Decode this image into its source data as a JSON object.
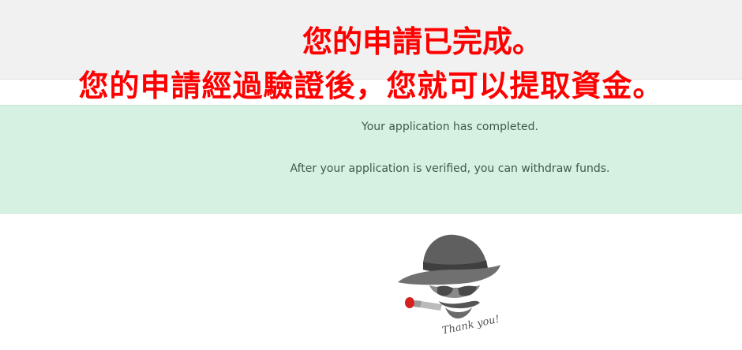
{
  "overlay": {
    "title_line1": "您的申請已完成。",
    "title_line2": "您的申請經過驗證後，您就可以提取資金。"
  },
  "notice": {
    "line1": "Your application has completed.",
    "line2": "After your application is verified, you can withdraw funds."
  },
  "logo": {
    "icon": "gangster-hat-cigar-icon",
    "caption": "Thank you!"
  },
  "colors": {
    "overlay_text": "#ff0000",
    "notice_background": "#d6f1e1",
    "notice_text": "#3d5a48",
    "top_band": "#f1f1f1"
  }
}
